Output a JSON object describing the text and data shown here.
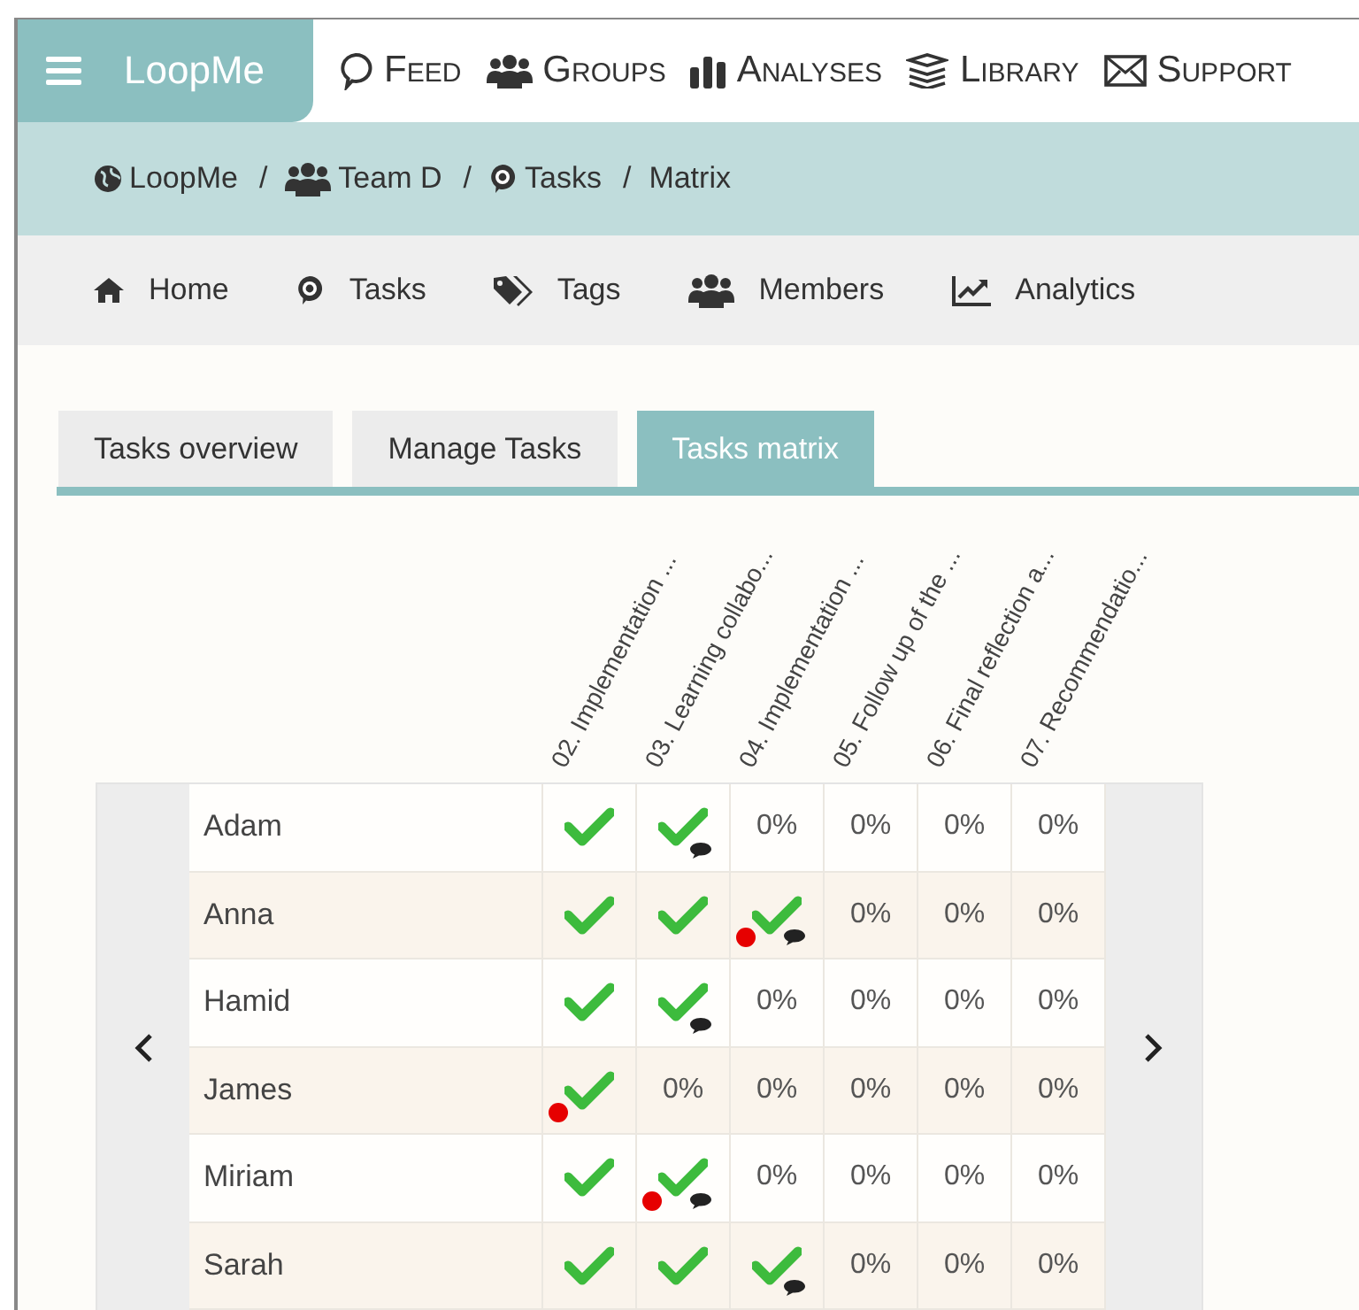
{
  "top_nav": {
    "brand": "LoopMe",
    "items": [
      {
        "label": "Feed"
      },
      {
        "label": "Groups"
      },
      {
        "label": "Analyses"
      },
      {
        "label": "Library"
      },
      {
        "label": "Support"
      }
    ]
  },
  "breadcrumb": [
    {
      "label": "LoopMe"
    },
    {
      "label": "Team D"
    },
    {
      "label": "Tasks"
    },
    {
      "label": "Matrix"
    }
  ],
  "breadcrumb_separators": [
    "/",
    "/",
    "/"
  ],
  "sub_nav": [
    {
      "label": "Home"
    },
    {
      "label": "Tasks"
    },
    {
      "label": "Tags"
    },
    {
      "label": "Members"
    },
    {
      "label": "Analytics"
    }
  ],
  "tabs": [
    {
      "label": "Tasks overview",
      "selected": false
    },
    {
      "label": "Manage Tasks",
      "selected": false
    },
    {
      "label": "Tasks matrix",
      "selected": true
    }
  ],
  "matrix": {
    "columns": [
      "02. Implementation ...",
      "03. Learning collabo...",
      "04. Implementation ...",
      "05. Follow up of the ...",
      "06. Final reflection a...",
      "07. Recommendatio..."
    ],
    "rows": [
      {
        "name": "Adam",
        "cells": [
          {
            "kind": "done",
            "comment": false,
            "flag": false
          },
          {
            "kind": "done",
            "comment": true,
            "flag": false
          },
          {
            "kind": "percent",
            "text": "0%"
          },
          {
            "kind": "percent",
            "text": "0%"
          },
          {
            "kind": "percent",
            "text": "0%"
          },
          {
            "kind": "percent",
            "text": "0%"
          }
        ]
      },
      {
        "name": "Anna",
        "cells": [
          {
            "kind": "done",
            "comment": false,
            "flag": false
          },
          {
            "kind": "done",
            "comment": false,
            "flag": false
          },
          {
            "kind": "done",
            "comment": true,
            "flag": true
          },
          {
            "kind": "percent",
            "text": "0%"
          },
          {
            "kind": "percent",
            "text": "0%"
          },
          {
            "kind": "percent",
            "text": "0%"
          }
        ]
      },
      {
        "name": "Hamid",
        "cells": [
          {
            "kind": "done",
            "comment": false,
            "flag": false
          },
          {
            "kind": "done",
            "comment": true,
            "flag": false
          },
          {
            "kind": "percent",
            "text": "0%"
          },
          {
            "kind": "percent",
            "text": "0%"
          },
          {
            "kind": "percent",
            "text": "0%"
          },
          {
            "kind": "percent",
            "text": "0%"
          }
        ]
      },
      {
        "name": "James",
        "cells": [
          {
            "kind": "done",
            "comment": false,
            "flag": true
          },
          {
            "kind": "percent",
            "text": "0%"
          },
          {
            "kind": "percent",
            "text": "0%"
          },
          {
            "kind": "percent",
            "text": "0%"
          },
          {
            "kind": "percent",
            "text": "0%"
          },
          {
            "kind": "percent",
            "text": "0%"
          }
        ]
      },
      {
        "name": "Miriam",
        "cells": [
          {
            "kind": "done",
            "comment": false,
            "flag": false
          },
          {
            "kind": "done",
            "comment": true,
            "flag": true
          },
          {
            "kind": "percent",
            "text": "0%"
          },
          {
            "kind": "percent",
            "text": "0%"
          },
          {
            "kind": "percent",
            "text": "0%"
          },
          {
            "kind": "percent",
            "text": "0%"
          }
        ]
      },
      {
        "name": "Sarah",
        "cells": [
          {
            "kind": "done",
            "comment": false,
            "flag": false
          },
          {
            "kind": "done",
            "comment": false,
            "flag": false
          },
          {
            "kind": "done",
            "comment": true,
            "flag": false
          },
          {
            "kind": "percent",
            "text": "0%"
          },
          {
            "kind": "percent",
            "text": "0%"
          },
          {
            "kind": "percent",
            "text": "0%"
          }
        ]
      }
    ]
  }
}
